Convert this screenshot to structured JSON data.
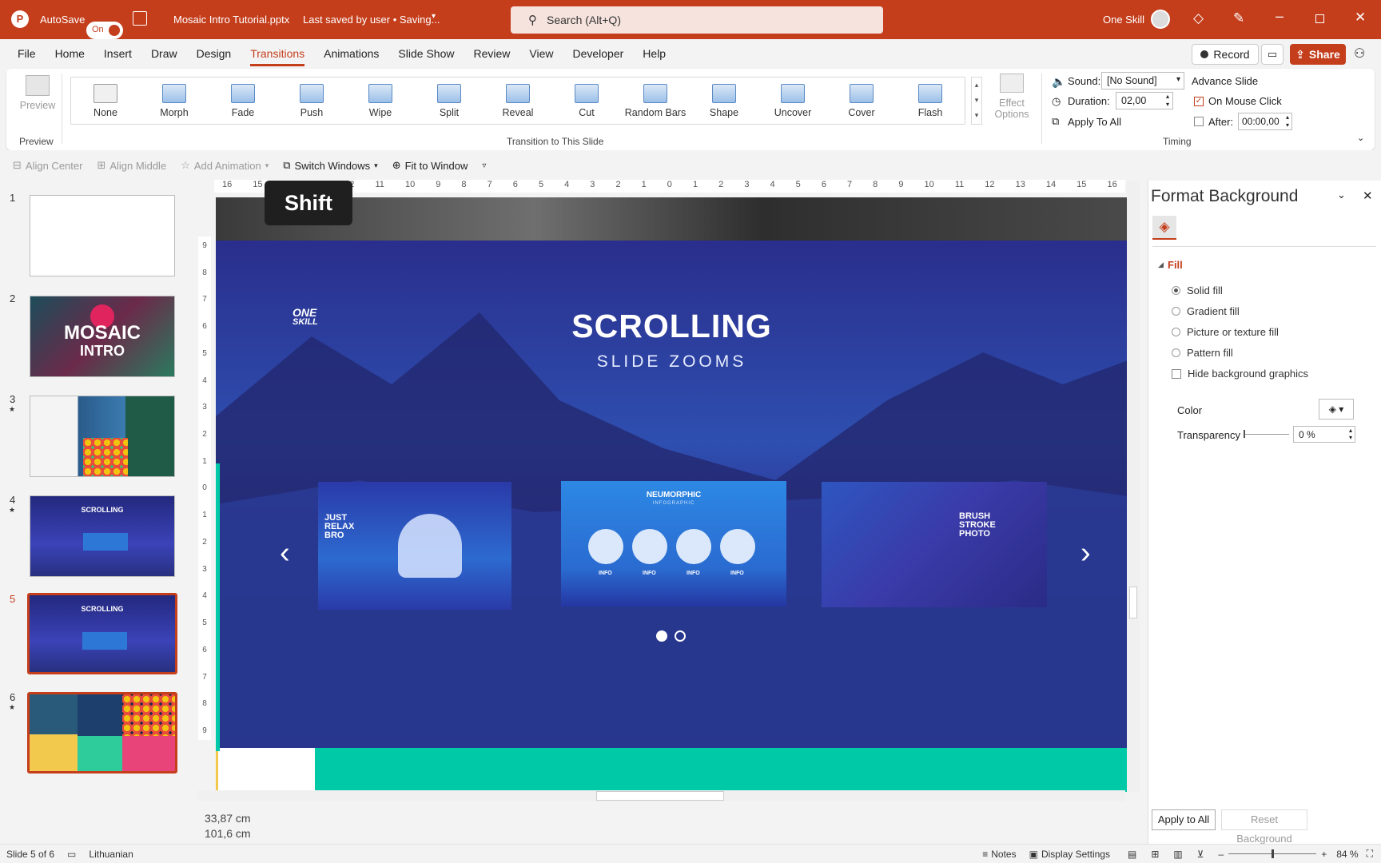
{
  "titlebar": {
    "autosave_label": "AutoSave",
    "autosave_state": "On",
    "file_title": "Mosaic Intro Tutorial.pptx",
    "save_status": "Last saved by user • Saving...",
    "search_placeholder": "Search (Alt+Q)",
    "account_name": "One Skill"
  },
  "menu": {
    "items": [
      "File",
      "Home",
      "Insert",
      "Draw",
      "Design",
      "Transitions",
      "Animations",
      "Slide Show",
      "Review",
      "View",
      "Developer",
      "Help"
    ],
    "active": "Transitions",
    "record_label": "Record",
    "share_label": "Share"
  },
  "ribbon": {
    "preview_label": "Preview",
    "preview_group": "Preview",
    "transitions": [
      "None",
      "Morph",
      "Fade",
      "Push",
      "Wipe",
      "Split",
      "Reveal",
      "Cut",
      "Random Bars",
      "Shape",
      "Uncover",
      "Cover",
      "Flash"
    ],
    "effect_options_line1": "Effect",
    "effect_options_line2": "Options",
    "transition_group": "Transition to This Slide",
    "sound_label": "Sound:",
    "sound_value": "[No Sound]",
    "duration_label": "Duration:",
    "duration_value": "02,00",
    "apply_all_label": "Apply To All",
    "advance_title": "Advance Slide",
    "on_mouse_click": "On Mouse Click",
    "after_label": "After:",
    "after_value": "00:00,00",
    "timing_group": "Timing"
  },
  "qat": {
    "align_center": "Align Center",
    "align_middle": "Align Middle",
    "add_animation": "Add Animation",
    "switch_windows": "Switch Windows",
    "fit_to_window": "Fit to Window"
  },
  "ruler": {
    "h_ticks": [
      "16",
      "15",
      "14",
      "13",
      "12",
      "11",
      "10",
      "9",
      "8",
      "7",
      "6",
      "5",
      "4",
      "3",
      "2",
      "1",
      "0",
      "1",
      "2",
      "3",
      "4",
      "5",
      "6",
      "7",
      "8",
      "9",
      "10",
      "11",
      "12",
      "13",
      "14",
      "15",
      "16"
    ],
    "v_ticks": [
      "9",
      "8",
      "7",
      "6",
      "5",
      "4",
      "3",
      "2",
      "1",
      "0",
      "1",
      "2",
      "3",
      "4",
      "5",
      "6",
      "7",
      "8",
      "9"
    ]
  },
  "key_overlay": "Shift",
  "slides": [
    {
      "num": "1",
      "star": false
    },
    {
      "num": "2",
      "star": false,
      "title": "MOSAIC",
      "subtitle": "INTRO"
    },
    {
      "num": "3",
      "star": true
    },
    {
      "num": "4",
      "star": true,
      "title": "SCROLLING"
    },
    {
      "num": "5",
      "star": false,
      "title": "SCROLLING"
    },
    {
      "num": "6",
      "star": true
    }
  ],
  "current_slide": {
    "logo_line1": "ONE",
    "logo_line2": "SKILL",
    "title": "SCROLLING",
    "subtitle": "SLIDE ZOOMS",
    "card_left": [
      "JUST",
      "RELAX",
      "BRO"
    ],
    "card_center_title": "NEUMORPHIC",
    "card_center_sub": "INFOGRAPHIC",
    "card_center_items": [
      "INFO",
      "INFO",
      "INFO",
      "INFO"
    ],
    "card_right": [
      "BRUSH",
      "STROKE",
      "PHOTO"
    ],
    "prev_arrow": "‹",
    "next_arrow": "›"
  },
  "format_panel": {
    "title": "Format Background",
    "section": "Fill",
    "options": [
      "Solid fill",
      "Gradient fill",
      "Picture or texture fill",
      "Pattern fill"
    ],
    "selected": "Solid fill",
    "hide_graphics": "Hide background graphics",
    "color_label": "Color",
    "transparency_label": "Transparency",
    "transparency_value": "0 %",
    "apply_all": "Apply to All",
    "reset": "Reset Background"
  },
  "coords": {
    "x": "33,87 cm",
    "y": "101,6 cm"
  },
  "status": {
    "slide_info": "Slide 5 of 6",
    "language": "Lithuanian",
    "notes": "Notes",
    "display_settings": "Display Settings",
    "zoom": "84 %"
  },
  "colors": {
    "brand": "#c43e1c",
    "slide_bg": "#2c2d8e",
    "accent_teal": "#00c9a7"
  }
}
